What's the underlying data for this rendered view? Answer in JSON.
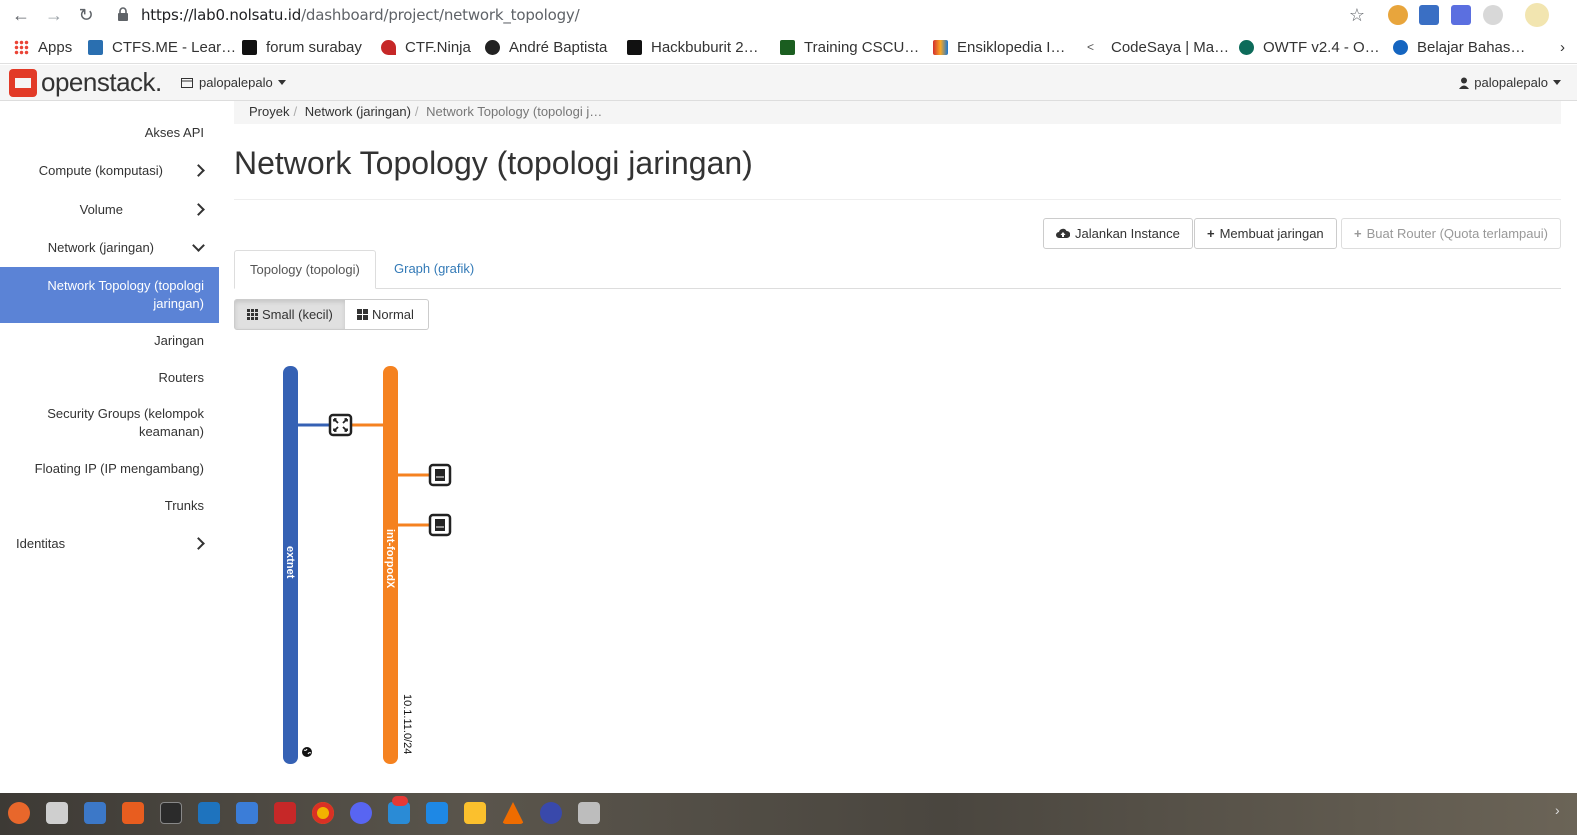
{
  "browser": {
    "url_host": "https://lab0.nolsatu.id",
    "url_path": "/dashboard/project/network_topology/",
    "bookmarks": [
      {
        "label": "Apps",
        "color": "#4285f4"
      },
      {
        "label": "CTFS.ME - Lear…",
        "color": "#2a6fb0"
      },
      {
        "label": "forum surabay",
        "color": "#111111"
      },
      {
        "label": "CTF.Ninja",
        "color": "#c62828"
      },
      {
        "label": "André Baptista",
        "color": "#222222"
      },
      {
        "label": "Hackbuburit 2…",
        "color": "#111111"
      },
      {
        "label": "Training CSCU…",
        "color": "#1b5e20"
      },
      {
        "label": "Ensiklopedia I…",
        "color": "#f9a825"
      },
      {
        "label": "CodeSaya | Ma…",
        "color": "#555555"
      },
      {
        "label": "OWTF v2.4 - O…",
        "color": "#0d6b5a"
      },
      {
        "label": "Belajar Bahas…",
        "color": "#1565c0"
      }
    ]
  },
  "navbar": {
    "logo": "openstack.",
    "project": "palopalepalo",
    "user": "palopalepalo"
  },
  "sidebar": {
    "items": [
      {
        "label": "Akses API"
      },
      {
        "label": "Compute (komputasi)"
      },
      {
        "label": "Volume"
      },
      {
        "label": "Network (jaringan)"
      },
      {
        "label": "Network Topology (topologi jaringan)"
      },
      {
        "label": "Jaringan"
      },
      {
        "label": "Routers"
      },
      {
        "label": "Security Groups (kelompok keamanan)"
      },
      {
        "label": "Floating IP (IP mengambang)"
      },
      {
        "label": "Trunks"
      },
      {
        "label": "Identitas"
      }
    ]
  },
  "breadcrumb": {
    "items": [
      "Proyek",
      "Network (jaringan)",
      "Network Topology (topologi j…"
    ]
  },
  "page": {
    "title": "Network Topology (topologi jaringan)",
    "actions": {
      "launch": "Jalankan Instance",
      "create_network": "Membuat jaringan",
      "create_router": "Buat Router (Quota terlampaui)"
    },
    "tabs": [
      "Topology (topologi)",
      "Graph (grafik)"
    ],
    "size_toggle": [
      "Small (kecil)",
      "Normal"
    ]
  },
  "topology": {
    "networks": [
      {
        "name": "extnet",
        "color": "#3561b4",
        "cidr": ""
      },
      {
        "name": "int-forpodX",
        "color": "#f58220",
        "cidr": "10.1.11.0/24"
      }
    ],
    "router_icon": "router-icon",
    "instance_icon": "instance-icon",
    "globe_icon": "globe-icon"
  }
}
